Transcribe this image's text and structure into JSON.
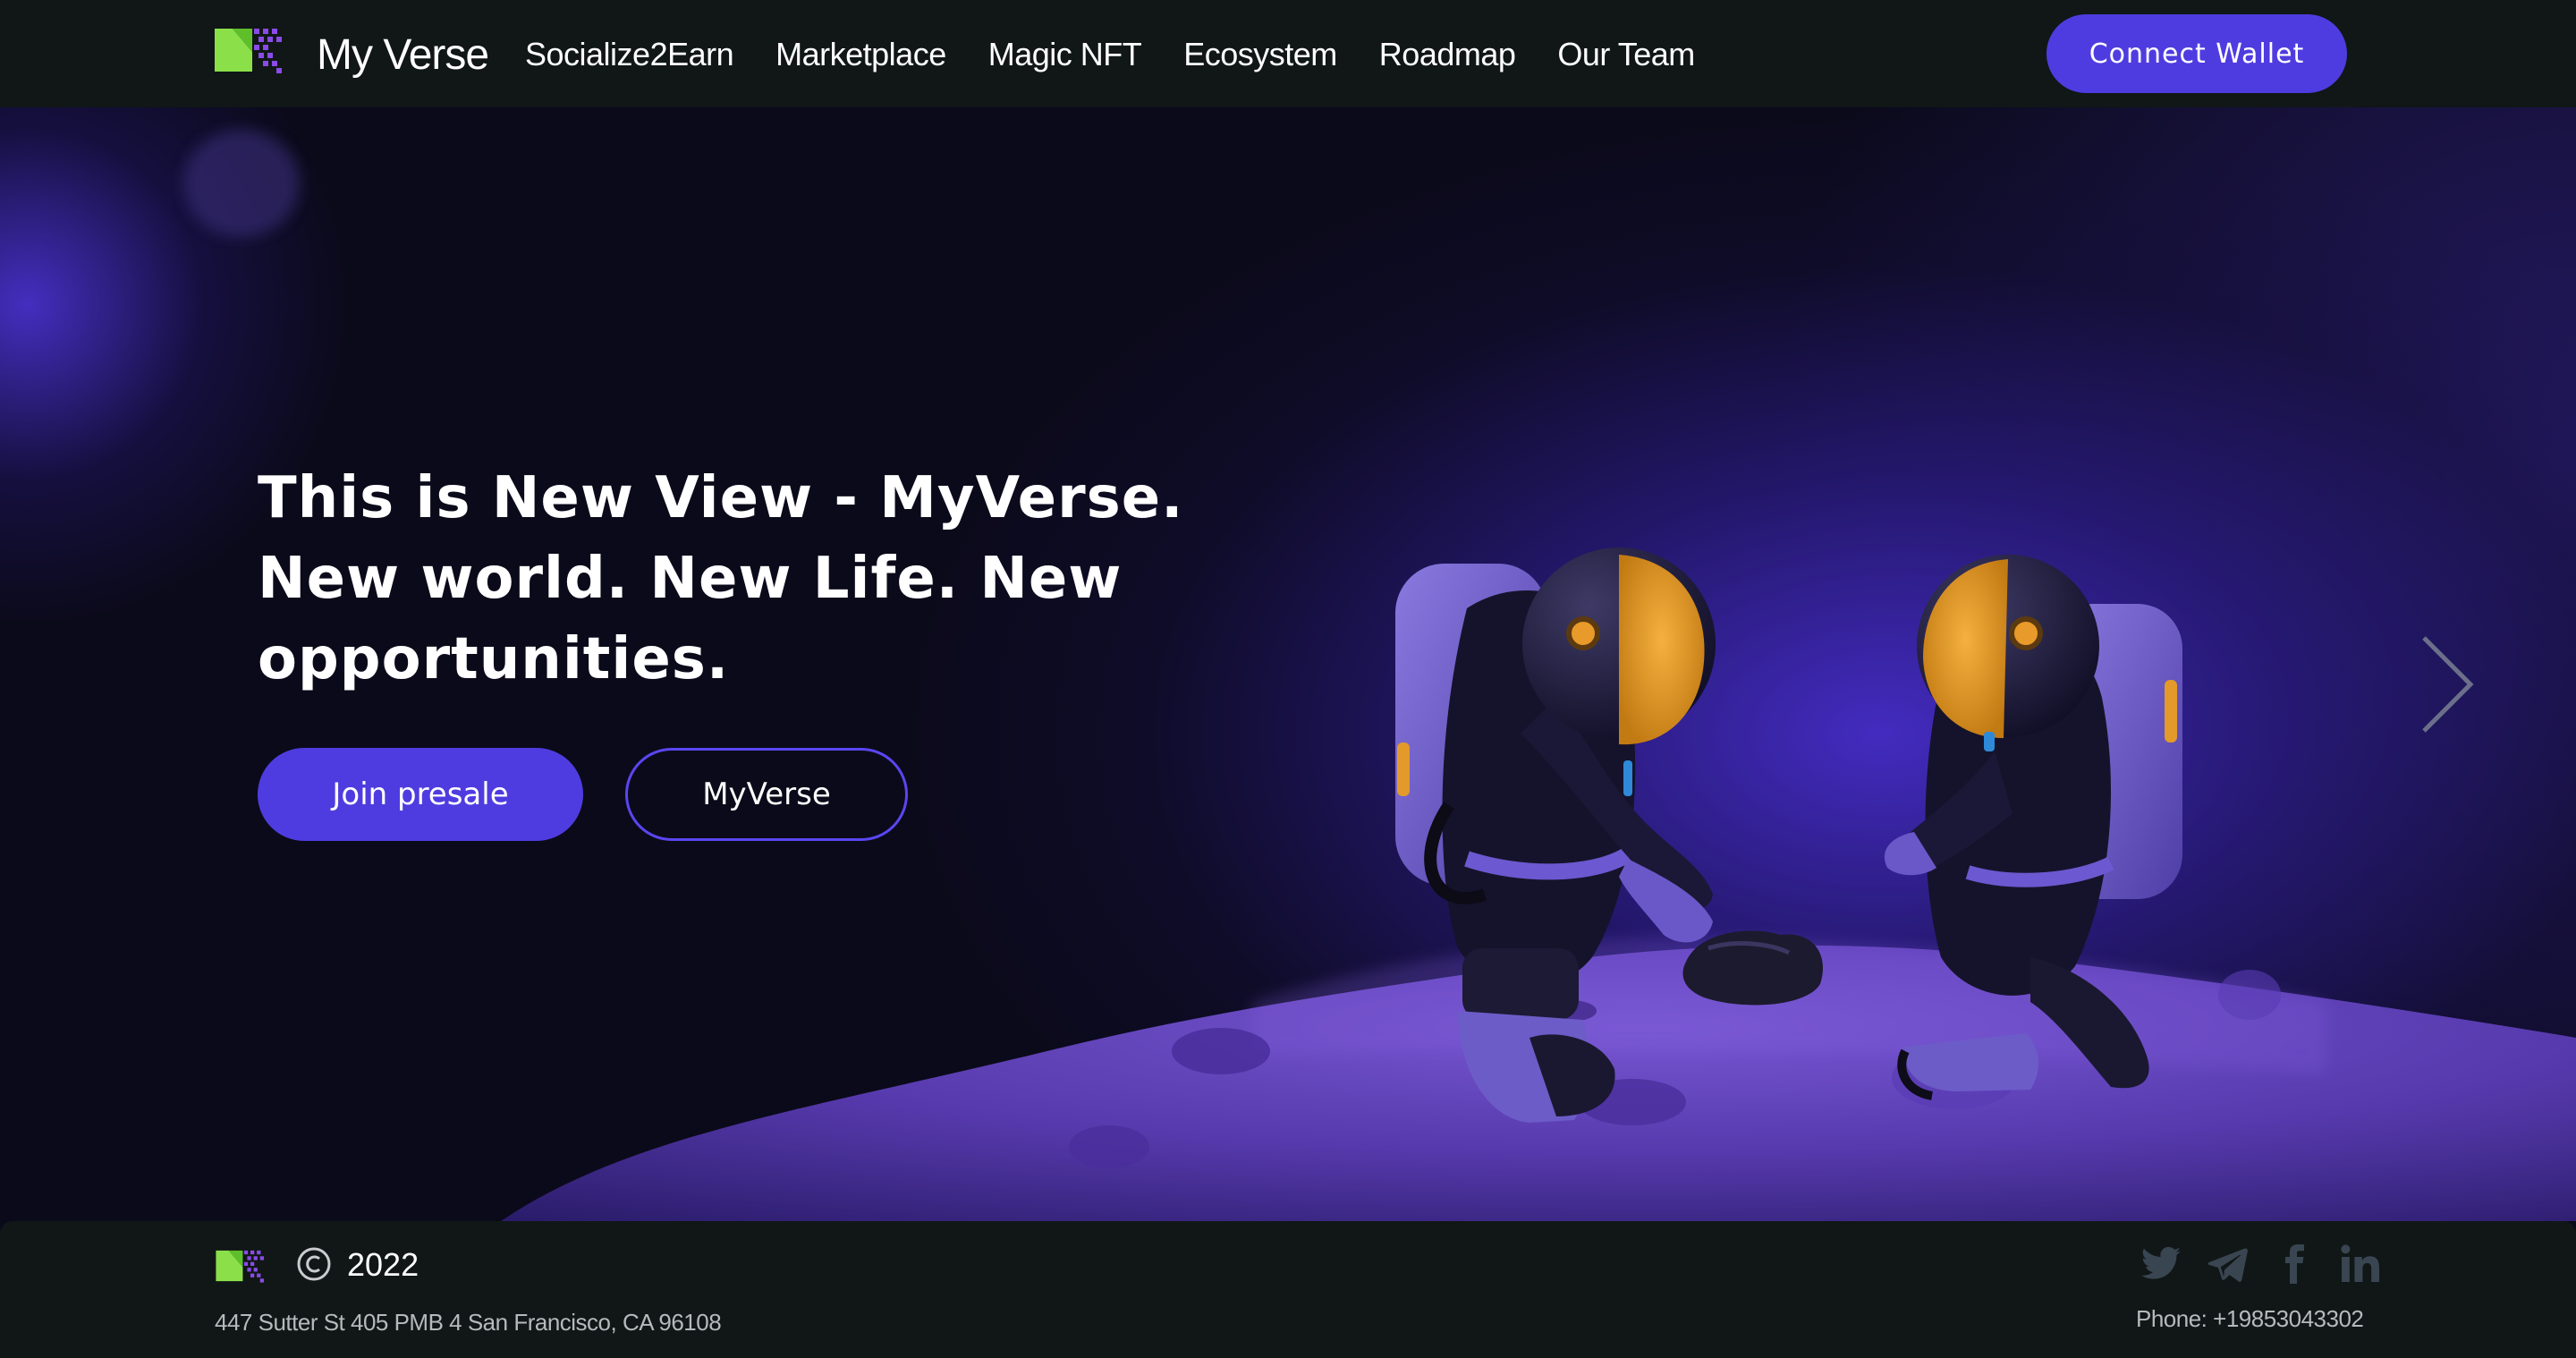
{
  "header": {
    "brand": "My Verse",
    "nav": [
      {
        "label": "Socialize2Earn"
      },
      {
        "label": "Marketplace"
      },
      {
        "label": "Magic NFT"
      },
      {
        "label": "Ecosystem"
      },
      {
        "label": "Roadmap"
      },
      {
        "label": "Our Team"
      }
    ],
    "connect_wallet": "Connect Wallet"
  },
  "hero": {
    "headline_lines": [
      "This is New View - MyVerse.",
      "New world. New Life. New",
      "opportunities."
    ],
    "join_presale": "Join presale",
    "myverse": "MyVerse",
    "next_icon": "chevron-right-icon"
  },
  "footer": {
    "copyright_icon": "copyright-icon",
    "year": "2022",
    "address": "447 Sutter St 405 PMB 4 San Francisco, CA 96108",
    "phone": "Phone: +19853043302",
    "socials": [
      {
        "icon": "twitter-icon"
      },
      {
        "icon": "telegram-icon"
      },
      {
        "icon": "facebook-icon"
      },
      {
        "icon": "linkedin-icon"
      }
    ]
  },
  "colors": {
    "accent": "#4f3ce0",
    "header_bg": "#101716",
    "hero_bg": "#0b0a1a",
    "logo_green": "#8be04a",
    "logo_purple": "#8a4be8"
  }
}
